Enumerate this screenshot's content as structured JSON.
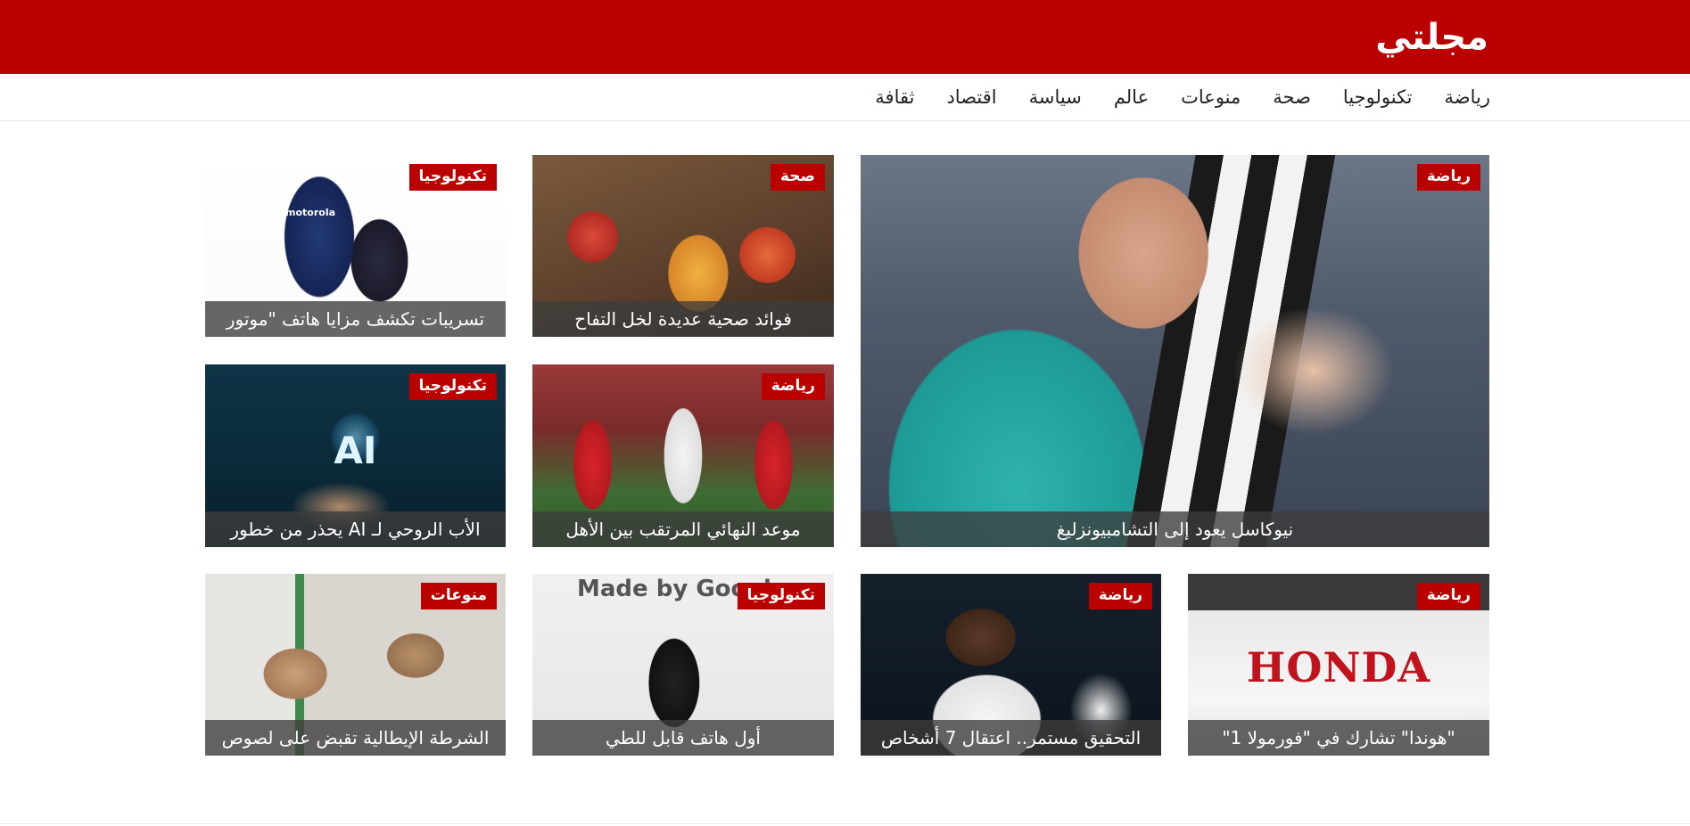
{
  "site": {
    "logo": "مجلتي"
  },
  "nav": {
    "items": [
      "رياضة",
      "تكنولوجيا",
      "صحة",
      "منوعات",
      "عالم",
      "سياسة",
      "اقتصاد",
      "ثقافة"
    ]
  },
  "cards": {
    "hero": {
      "category": "رياضة",
      "title": "نيوكاسل يعود إلى التشامبيونزليغ",
      "image_icon": "football-celebration-photo"
    },
    "apple": {
      "category": "صحة",
      "title": "فوائد صحية عديدة لخل التفاح",
      "image_icon": "apple-vinegar-photo"
    },
    "moto": {
      "category": "تكنولوجيا",
      "title": "تسريبات تكشف مزايا هاتف \"موتور",
      "image_icon": "smartphone-photo",
      "brand_text": "motorola"
    },
    "football": {
      "category": "رياضة",
      "title": "موعد النهائي المرتقب بين الأهل",
      "image_icon": "football-match-photo"
    },
    "ai": {
      "category": "تكنولوجيا",
      "title": "الأب الروحي لـ AI يحذر من خطور",
      "image_icon": "ai-hand-photo",
      "overlay_text": "AI"
    },
    "honda": {
      "category": "رياضة",
      "title": "\"هوندا\" تشارك في \"فورمولا 1\"",
      "image_icon": "honda-sign-photo",
      "overlay_text": "HONDA"
    },
    "vini": {
      "category": "رياضة",
      "title": "التحقيق مستمر.. اعتقال 7 أشخاص",
      "image_icon": "football-player-photo"
    },
    "pixel": {
      "category": "تكنولوجيا",
      "title": "أول هاتف قابل للطي",
      "image_icon": "foldable-phone-photo",
      "overlay_text": "Made by Google"
    },
    "pottery": {
      "category": "منوعات",
      "title": "الشرطة الإيطالية تقبض على لصوص",
      "image_icon": "ancient-pottery-photo"
    }
  },
  "colors": {
    "brand": "#bb0000",
    "caption_bg": "rgba(60,60,60,0.78)"
  }
}
